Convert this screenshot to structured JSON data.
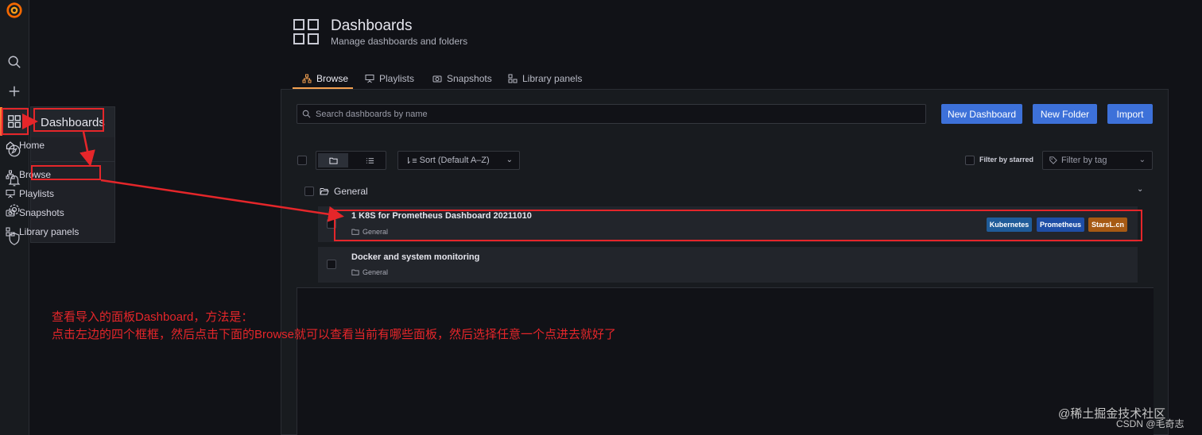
{
  "header": {
    "title": "Dashboards",
    "subtitle": "Manage dashboards and folders"
  },
  "tabs": [
    {
      "label": "Browse",
      "icon": "sitemap-icon",
      "active": true
    },
    {
      "label": "Playlists",
      "icon": "presentation-icon",
      "active": false
    },
    {
      "label": "Snapshots",
      "icon": "camera-icon",
      "active": false
    },
    {
      "label": "Library panels",
      "icon": "library-icon",
      "active": false
    }
  ],
  "flyout": {
    "title": "Dashboards",
    "items": [
      {
        "label": "Home",
        "icon": "home-icon"
      },
      {
        "label": "Browse",
        "icon": "sitemap-icon"
      },
      {
        "label": "Playlists",
        "icon": "presentation-icon"
      },
      {
        "label": "Snapshots",
        "icon": "camera-icon"
      },
      {
        "label": "Library panels",
        "icon": "library-icon"
      }
    ]
  },
  "toolbar": {
    "search_placeholder": "Search dashboards by name",
    "new_dashboard": "New Dashboard",
    "new_folder": "New Folder",
    "import": "Import",
    "sort_label": "Sort (Default A–Z)",
    "filter_starred": "Filter by starred",
    "filter_tag_placeholder": "Filter by tag"
  },
  "folder": {
    "name": "General",
    "dashboards": [
      {
        "title": "1 K8S for Prometheus Dashboard 20211010",
        "folder": "General",
        "tags": [
          {
            "label": "Kubernetes",
            "color": "#1f5c99"
          },
          {
            "label": "Prometheus",
            "color": "#1f4ea6"
          },
          {
            "label": "StarsL.cn",
            "color": "#a65a14"
          }
        ]
      },
      {
        "title": "Docker and system monitoring",
        "folder": "General",
        "tags": []
      }
    ]
  },
  "annotation": {
    "line1": "查看导入的面板Dashboard，方法是：",
    "line2": "点击左边的四个框框，然后点击下面的Browse就可以查看当前有哪些面板，然后选择任意一个点进去就好了",
    "color": "#e5262a"
  },
  "watermark": {
    "line1": "@稀土掘金技术社区",
    "line2": "CSDN @毛奇志"
  },
  "colors": {
    "primary_button": "#3d71d9",
    "active_tab_underline": "#f5a151",
    "background": "#111217"
  }
}
